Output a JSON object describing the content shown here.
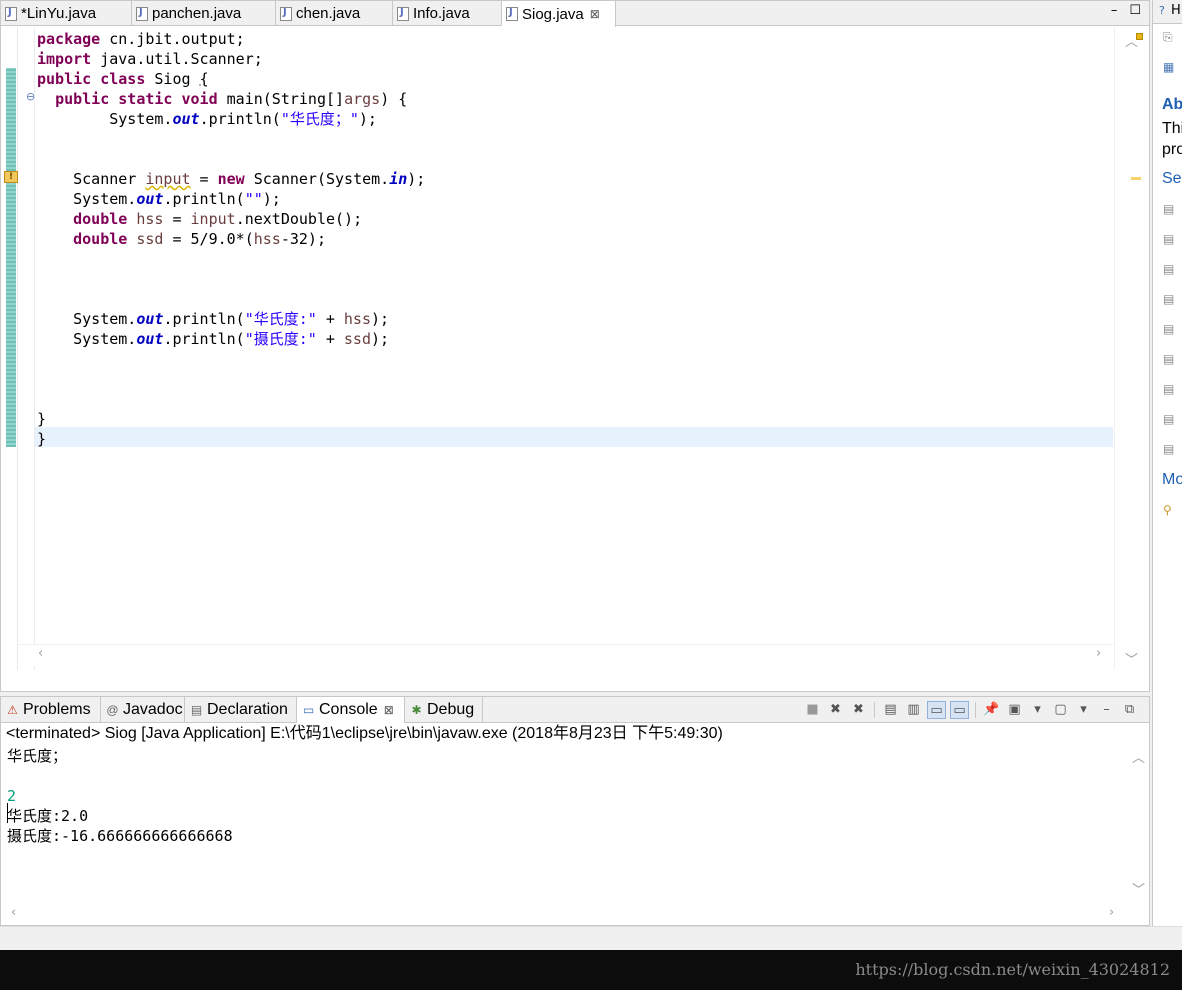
{
  "editor": {
    "tabs": [
      {
        "label": "*LinYu.java"
      },
      {
        "label": "panchen.java"
      },
      {
        "label": "chen.java"
      },
      {
        "label": "Info.java"
      },
      {
        "label": "Siog.java",
        "close": "⊠"
      }
    ],
    "controls": {
      "minimize": "–",
      "maximize": "☐"
    },
    "code": {
      "l1": {
        "kw": "package",
        "rest": " cn.jbit.output;"
      },
      "l2": {
        "kw": "import",
        "rest": " java.util.Scanner;"
      },
      "l3": {
        "kw1": "public",
        "kw2": "class",
        "name": " Siog ",
        "brace": "{"
      },
      "l4": {
        "kw1": "public",
        "kw2": "static",
        "kw3": "void",
        "rest": " main(String[]",
        "args": "args",
        "tail": ") {"
      },
      "l5": {
        "a": "System.",
        "out": "out",
        "b": ".println(",
        "str": "\"华氏度；\"",
        "c": ");"
      },
      "l8": {
        "a": "Scanner ",
        "var": "input",
        "b": " = ",
        "kw": "new",
        "c": " Scanner(System.",
        "in": "in",
        "d": ");"
      },
      "l9": {
        "a": "System.",
        "out": "out",
        "b": ".println(",
        "str": "\"\"",
        "c": ");"
      },
      "l10": {
        "kw": "double",
        "var": " hss",
        "b": " = ",
        "var2": "input",
        "c": ".nextDouble();"
      },
      "l11": {
        "kw": "double",
        "var": " ssd",
        "b": " = 5/9.0*(",
        "var2": "hss",
        "c": "-32);"
      },
      "l15": {
        "a": "System.",
        "out": "out",
        "b": ".println(",
        "str": "\"华氏度:\"",
        "c": " + ",
        "var": "hss",
        "d": ");"
      },
      "l16": {
        "a": "System.",
        "out": "out",
        "b": ".println(",
        "str": "\"摄氏度:\"",
        "c": " + ",
        "var": "ssd",
        "d": ");"
      },
      "l20": {
        "a": "}"
      },
      "l21": {
        "a": "}"
      }
    }
  },
  "right_panel": {
    "title": "Ab",
    "desc1": "Thi",
    "desc2": "pro",
    "link1": "Sec",
    "link2": "Mo",
    "tab_label": "H"
  },
  "console": {
    "tabs": [
      {
        "label": "Problems",
        "icon": "problems-icon"
      },
      {
        "label": "Javadoc",
        "icon": "at-icon"
      },
      {
        "label": "Declaration",
        "icon": "declaration-icon"
      },
      {
        "label": "Console",
        "icon": "console-icon",
        "close": "⊠"
      },
      {
        "label": "Debug",
        "icon": "bug-icon"
      }
    ],
    "status": "<terminated> Siog [Java Application] E:\\代码1\\eclipse\\jre\\bin\\javaw.exe (2018年8月23日 下午5:49:30)",
    "output": {
      "line1": "华氏度；",
      "line2": "",
      "line3": "2",
      "line4": "华氏度:2.0",
      "line5": "摄氏度:-16.666666666666668"
    },
    "input_color": "#00a07a"
  },
  "watermark": "https://blog.csdn.net/weixin_43024812",
  "colors": {
    "keyword": "#7f0055",
    "string": "#2a00ff",
    "field": "#0000c0",
    "variable": "#6a3e3e",
    "current_line": "#e8f2fe"
  }
}
